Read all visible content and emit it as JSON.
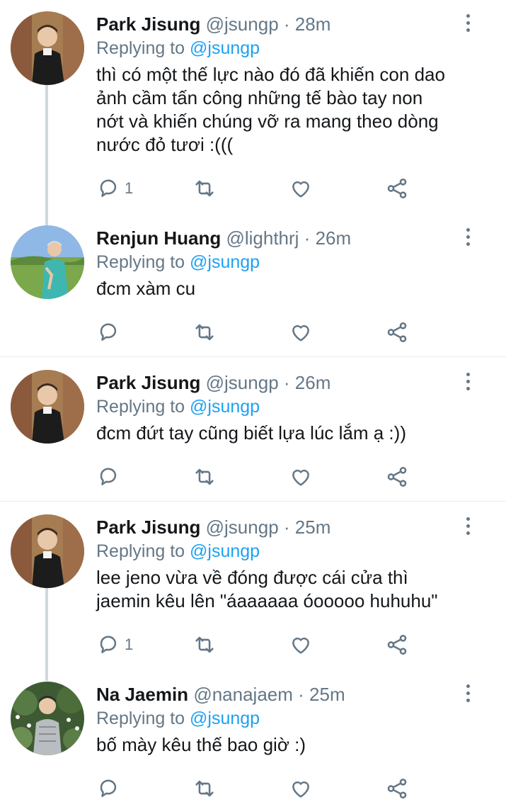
{
  "tweets": [
    {
      "name": "Park Jisung",
      "handle": "@jsungp",
      "dot": "·",
      "time": "28m",
      "replying_label": "Replying to",
      "replying_to": "@jsungp",
      "text": "thì có một thế lực nào đó đã khiến con dao\nảnh cầm tấn công những tế bào tay non\nnớt và khiến chúng vỡ ra mang theo dòng\nnước đỏ tươi :(((",
      "reply_count": "1",
      "retweet_count": "",
      "like_count": ""
    },
    {
      "name": "Renjun Huang",
      "handle": "@lighthrj",
      "dot": "·",
      "time": "26m",
      "replying_label": "Replying to",
      "replying_to": "@jsungp",
      "text": "đcm xàm cu",
      "reply_count": "",
      "retweet_count": "",
      "like_count": ""
    },
    {
      "name": "Park Jisung",
      "handle": "@jsungp",
      "dot": "·",
      "time": "26m",
      "replying_label": "Replying to",
      "replying_to": "@jsungp",
      "text": "đcm đứt tay cũng biết lựa lúc lắm ạ :))",
      "reply_count": "",
      "retweet_count": "",
      "like_count": ""
    },
    {
      "name": "Park Jisung",
      "handle": "@jsungp",
      "dot": "·",
      "time": "25m",
      "replying_label": "Replying to",
      "replying_to": "@jsungp",
      "text": "lee jeno vừa về đóng được cái cửa thì\njaemin kêu lên \"áaaaaaa óooooo huhuhu\"",
      "reply_count": "1",
      "retweet_count": "",
      "like_count": ""
    },
    {
      "name": "Na Jaemin",
      "handle": "@nanajaem",
      "dot": "·",
      "time": "25m",
      "replying_label": "Replying to",
      "replying_to": "@jsungp",
      "text": "bố mày kêu thế bao giờ :)",
      "reply_count": "",
      "retweet_count": "",
      "like_count": ""
    }
  ],
  "icons": {
    "reply": "reply-icon",
    "retweet": "retweet-icon",
    "like": "heart-icon",
    "share": "share-icon",
    "more": "more-vertical-icon"
  },
  "colors": {
    "name": "#14171a",
    "secondary": "#657786",
    "mention": "#1da1f2",
    "thread_line": "#cfd9de",
    "divider": "#e6ecf0"
  }
}
